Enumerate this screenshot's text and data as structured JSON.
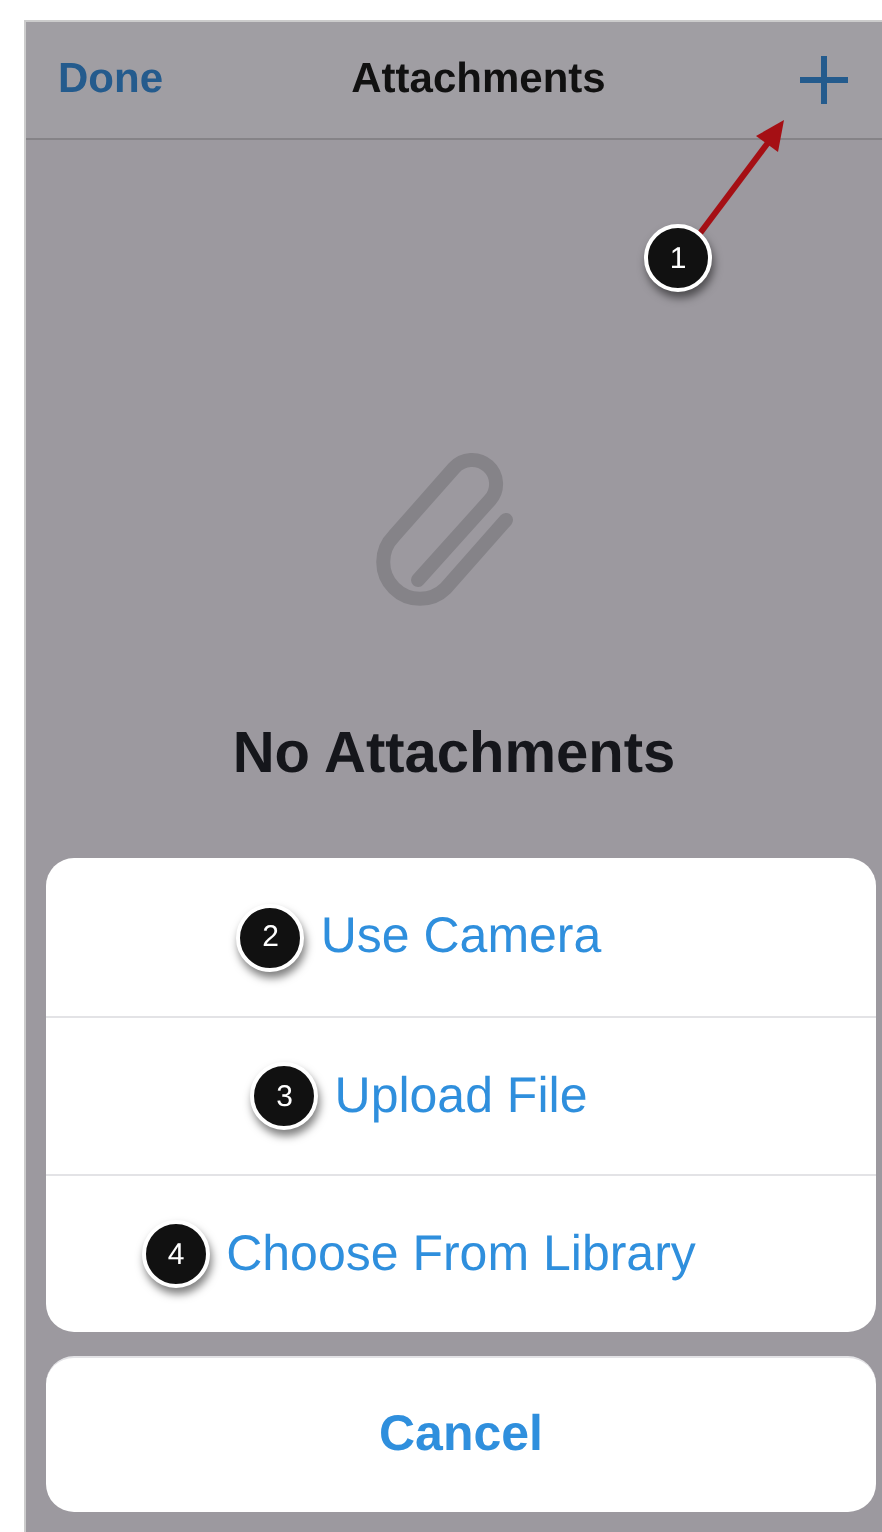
{
  "nav_bar": {
    "left_button": "Done",
    "title": "Attachments",
    "add_callout": "1"
  },
  "empty_state": {
    "title": "No Attachments"
  },
  "action_sheet": {
    "actions": [
      {
        "label": "Use Camera",
        "callout": "2"
      },
      {
        "label": "Upload File",
        "callout": "3"
      },
      {
        "label": "Choose From Library",
        "callout": "4"
      }
    ],
    "cancel": "Cancel"
  }
}
